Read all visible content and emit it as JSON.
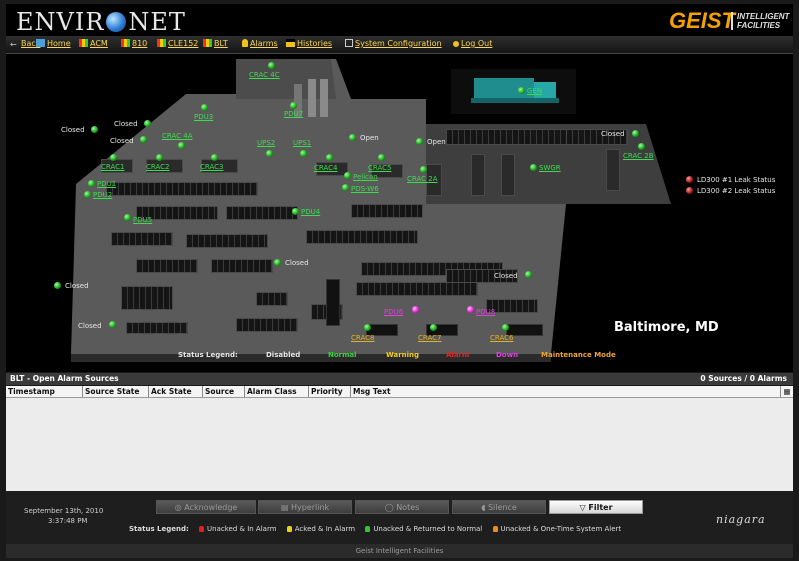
{
  "header": {
    "app_logo": "ENVIRO NET",
    "brand": "GEIST",
    "brand_tagline": "INTELLIGENT FACILITIES"
  },
  "nav": [
    "Back",
    "Home",
    "ACM",
    "810",
    "CLE152",
    "BLT",
    "Alarms",
    "Histories",
    "System Configuration",
    "Log Out"
  ],
  "map": {
    "location": "Baltimore, MD",
    "crac_labels": [
      "CRAC 4C",
      "CRAC 4A",
      "CRAC1",
      "CRAC2",
      "CRAC3",
      "CRAC4",
      "CRAC5",
      "CRAC 2A",
      "CRAC 2B",
      "CRAC8",
      "CRAC7",
      "CRAC6"
    ],
    "pdu_labels": [
      "PDU1",
      "PDU2",
      "PDU3",
      "PDU4",
      "PDU5",
      "PDU6",
      "PDU7",
      "PDU8"
    ],
    "ups_labels": [
      "UPS1",
      "UPS2"
    ],
    "other_labels": [
      "GEN",
      "SWGR",
      "Pelican",
      "PDS-W6"
    ],
    "door_states": [
      "Closed",
      "Closed",
      "Closed",
      "Open",
      "Open",
      "Closed",
      "Closed",
      "Closed",
      "Closed",
      "Closed"
    ],
    "leak": [
      "LD300 #1 Leak Status",
      "LD300 #2 Leak Status"
    ],
    "legend": {
      "title": "Status Legend:",
      "items": [
        "Disabled",
        "Normal",
        "Warning",
        "Alarm",
        "Down",
        "Maintenance Mode"
      ],
      "colors": [
        "#e8e8e8",
        "#37d23a",
        "#f3cf1a",
        "#f02020",
        "#e23ee0",
        "#f2a52a"
      ]
    }
  },
  "alarm_panel": {
    "title": "BLT - Open Alarm Sources",
    "summary": "0 Sources / 0 Alarms",
    "columns": [
      "Timestamp",
      "Source State",
      "Ack State",
      "Source",
      "Alarm Class",
      "Priority",
      "Msg Text"
    ]
  },
  "bottom": {
    "date": "September 13th, 2010",
    "time": "3:37:48 PM",
    "buttons": [
      "Acknowledge",
      "Hyperlink",
      "Notes",
      "Silence",
      "Filter"
    ],
    "status_legend_title": "Status Legend:",
    "status_items": [
      "Unacked & In Alarm",
      "Acked & In Alarm",
      "Unacked & Returned to Normal",
      "Unacked & One-Time System Alert"
    ],
    "status_colors": [
      "#e02020",
      "#e6d21a",
      "#37c23a",
      "#f08a20"
    ],
    "powered_by": "niagara"
  },
  "footer": {
    "text": "Geist Intelligent Facilities"
  }
}
